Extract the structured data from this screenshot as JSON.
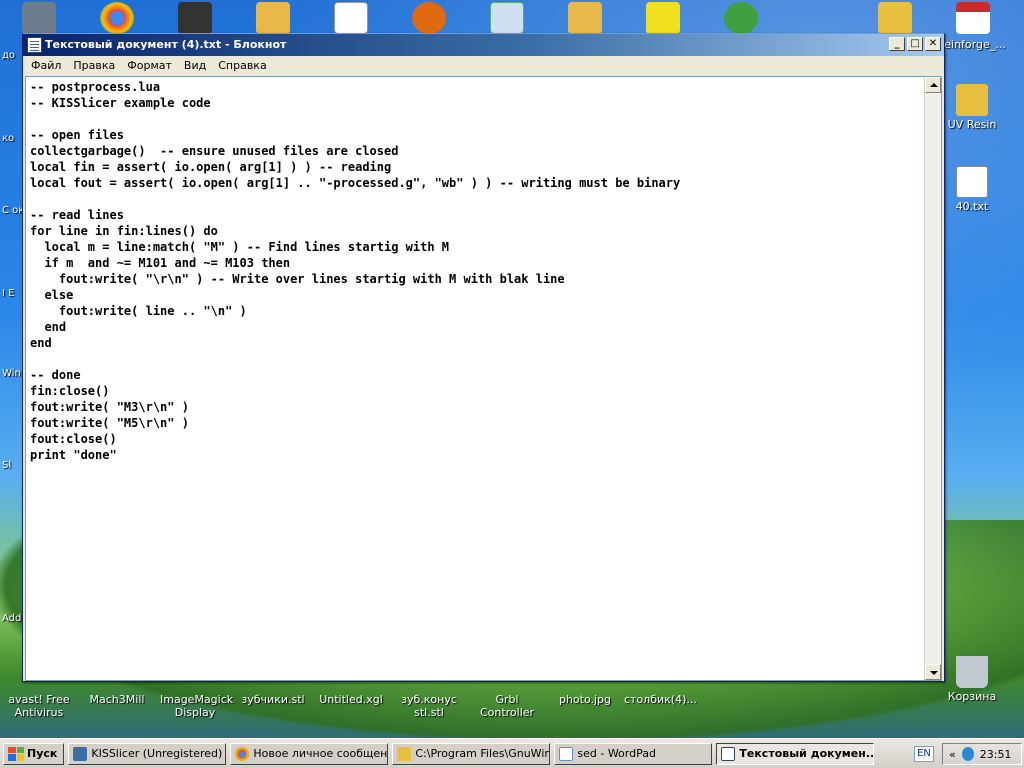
{
  "desktop": {
    "bottom_icons": [
      {
        "label": "avast! Free Antivirus",
        "color": "#e06a10"
      },
      {
        "label": "Mach3Mill",
        "color": "#444444"
      },
      {
        "label": "ImageMagick Display",
        "color": "#8a6fbf"
      },
      {
        "label": "зубчики.stl",
        "color": "#d9a040"
      },
      {
        "label": "Untitled.xgl",
        "color": "#3a6ea5"
      },
      {
        "label": "зуб.конус stl.stl",
        "color": "#d9a040"
      },
      {
        "label": "Grbl Controller",
        "color": "#c03030"
      },
      {
        "label": "photo.jpg",
        "color": "#7aa0c0"
      },
      {
        "label": "столбик(4)...",
        "color": "#d9a040"
      }
    ],
    "right_icons": [
      {
        "label": "keinforge_...",
        "color": "#cc2a2a"
      },
      {
        "label": "UV Resin",
        "color": "#e8c040"
      },
      {
        "label": "40.txt",
        "color": "#ffffff"
      },
      {
        "label": "Корзина",
        "color": "#c0c8d0"
      }
    ],
    "edge_fragments": [
      "до",
      "ко",
      "C ок",
      "I E",
      "Win",
      "Sl",
      "Add"
    ]
  },
  "window": {
    "title": "Текстовый документ (4).txt - Блокнот",
    "minimize": "_",
    "maximize": "□",
    "close": "✕",
    "menu": [
      "Файл",
      "Правка",
      "Формат",
      "Вид",
      "Справка"
    ],
    "content": "-- postprocess.lua\n-- KISSlicer example code\n\n-- open files\ncollectgarbage()  -- ensure unused files are closed\nlocal fin = assert( io.open( arg[1] ) ) -- reading\nlocal fout = assert( io.open( arg[1] .. \"-processed.g\", \"wb\" ) ) -- writing must be binary\n\n-- read lines\nfor line in fin:lines() do\n  local m = line:match( \"M\" ) -- Find lines startig with M\n  if m  and ~= M101 and ~= M103 then\n    fout:write( \"\\r\\n\" ) -- Write over lines startig with M with blak line\n  else\n    fout:write( line .. \"\\n\" )\n  end\nend\n\n-- done\nfin:close()\nfout:write( \"M3\\r\\n\" )\nfout:write( \"M5\\r\\n\" )\nfout:close()\nprint \"done\""
  },
  "taskbar": {
    "start_label": "Пуск",
    "tasks": [
      {
        "label": "KISSlicer (Unregistered)",
        "color": "#3a6ea5"
      },
      {
        "label": "Новое личное сообщен...",
        "color": "#e04a2a"
      },
      {
        "label": "C:\\Program Files\\GnuWin...",
        "color": "#e8c040"
      },
      {
        "label": "sed - WordPad",
        "color": "#6090c0"
      },
      {
        "label": "Текстовый докумен...",
        "color": "#3a6ea5"
      }
    ],
    "lang": "EN",
    "chevron": "«",
    "time": "23:51"
  }
}
